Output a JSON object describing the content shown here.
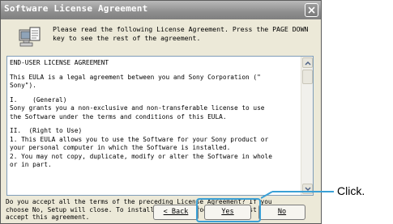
{
  "window": {
    "title": "Software License Agreement",
    "close_icon": "close-icon"
  },
  "header": {
    "icon": "license-document-icon",
    "text": "Please read the following License Agreement.  Press the PAGE DOWN\nkey to see the rest of the agreement."
  },
  "license": {
    "lines": [
      "END-USER LICENSE AGREEMENT",
      "",
      "This EULA is a legal agreement between you and Sony Corporation (\"",
      "Sony\").",
      "",
      "I.    (General)",
      "Sony grants you a non-exclusive and non-transferable license to use",
      "the Software under the terms and conditions of this EULA.",
      "",
      "II.  (Right to Use)",
      "1. This EULA allows you to use the Software for your Sony product or",
      "your personal computer in which the Software is installed.",
      "2. You may not copy, duplicate, modify or alter the Software in whole",
      "or in part."
    ]
  },
  "question": "Do you accept all the terms of the preceding License Agreement?  If you\nchoose No,  Setup will close.  To install IP Setup Program, you must\naccept this agreement.",
  "buttons": {
    "back": "< Back",
    "yes": "Yes",
    "no": "No"
  },
  "callout": {
    "label": "Click.",
    "color": "#3aa0d6"
  }
}
